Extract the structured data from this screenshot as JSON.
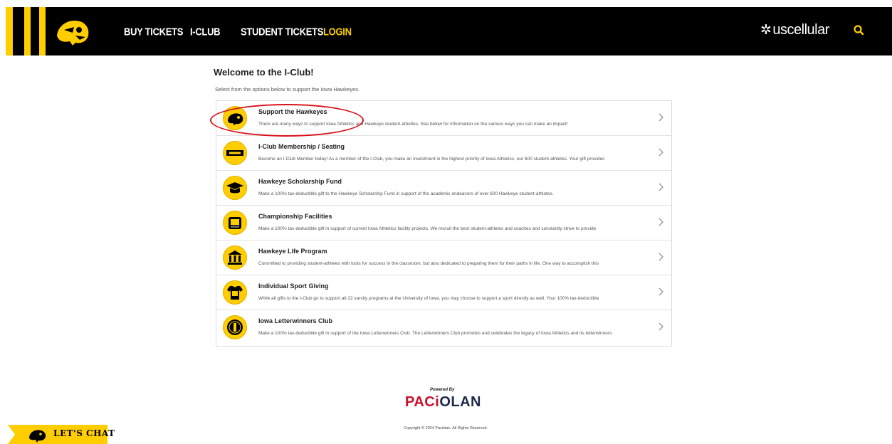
{
  "header": {
    "nav": [
      "BUY TICKETS",
      "I-CLUB",
      "STUDENT TICKETS",
      "LOGIN"
    ],
    "sponsor": "uscellular",
    "logo_icon": "hawkeye-logo-icon",
    "search_icon": "search-icon"
  },
  "main": {
    "title": "Welcome to the I-Club!",
    "subtitle": "Select from the options below to support the Iowa Hawkeyes.",
    "items": [
      {
        "title": "Support the Hawkeyes",
        "description": "There are many ways to support Iowa Athletics and Hawkeye student-atheltes. See below for information on the various ways you can make an impact!",
        "icon": "hawkeye-icon"
      },
      {
        "title": "I-Club Membership / Seating",
        "description": "Become an I-Club Member today! As a member of the I-Club, you make an investment in the highest priority of Iowa Athletics, our 600 student-athletes. Your gift provides",
        "icon": "iclub-badge-icon"
      },
      {
        "title": "Hawkeye Scholarship Fund",
        "description": "Make a 100% tax-deductible gift to the Hawkeye Scholarship Fund in support of the academic endeavors of over 600 Hawkeye student-athletes.",
        "icon": "graduation-cap-icon"
      },
      {
        "title": "Championship Facilities",
        "description": "Make a 100% tax-deductible gift in support of current Iowa Athletics facility projects. We recruit the best student-athletes and coaches and constantly strive to provide",
        "icon": "stadium-icon"
      },
      {
        "title": "Hawkeye Life Program",
        "description": "Committed to providing student-athletes with tools for success in the classroom, but also dedicated to preparing them for their paths in life. One way to accomplish this",
        "icon": "institution-icon"
      },
      {
        "title": "Individual Sport Giving",
        "description": "While all gifts to the I-Club go to support all 22 varsity programs at the University of Iowa, you may choose to support a sport directly as well. Your 100% tax-deductible",
        "icon": "jersey-icon"
      },
      {
        "title": "Iowa Letterwinners Club",
        "description": "Make a 100% tax-deductible gift in support of the Iowa Letterwinners Club. The Letterwinners Club promotes and celebrates the legacy of Iowa Athletics and its letterwinners",
        "icon": "letterwinners-seal-icon"
      }
    ]
  },
  "footer": {
    "powered_by": "Powered By",
    "brand_red": "PACi",
    "brand_navy": "OLAN",
    "copyright": "Copyright © 2024 Paciolan. All Rights Reserved."
  },
  "chat": {
    "label": "LET'S CHAT"
  },
  "colors": {
    "gold": "#ffcd00",
    "black": "#000000",
    "highlight": "#d8121a",
    "paciolan_red": "#c8102e",
    "paciolan_navy": "#1c2a4a"
  }
}
